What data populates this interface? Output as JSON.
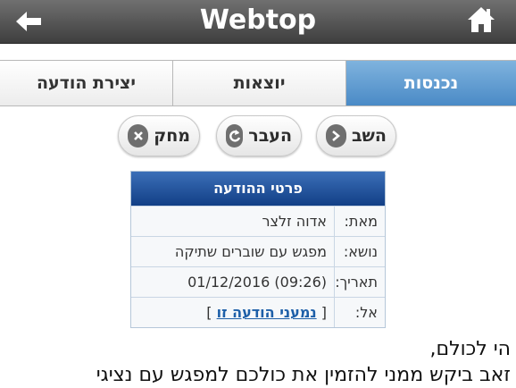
{
  "app": {
    "title": "Webtop"
  },
  "tabs": [
    {
      "label": "יצירת הודעה"
    },
    {
      "label": "יוצאות"
    },
    {
      "label": "נכנסות"
    }
  ],
  "actions": {
    "back_label": "השב",
    "forward_label": "העבר",
    "delete_label": "מחק"
  },
  "details": {
    "header": "פרטי ההודעה",
    "from_key": "מאת:",
    "from_value": "אדוה זלצר",
    "subject_key": "נושא:",
    "subject_value": "מפגש עם שוברים שתיקה",
    "date_key": "תאריך:",
    "date_value": "01/12/2016 (09:26)",
    "to_key": "אל:",
    "to_link": "נמעני הודעה זו",
    "to_open": "[",
    "to_close": "]"
  },
  "message": {
    "line1": "הי לכולם,",
    "line2": "זאב ביקש ממני להזמין את כולכם למפגש עם נציגי"
  },
  "colors": {
    "active_tab": "#4a8ac6",
    "header_blue": "#123f86",
    "topbar": "#3e3e3e"
  }
}
